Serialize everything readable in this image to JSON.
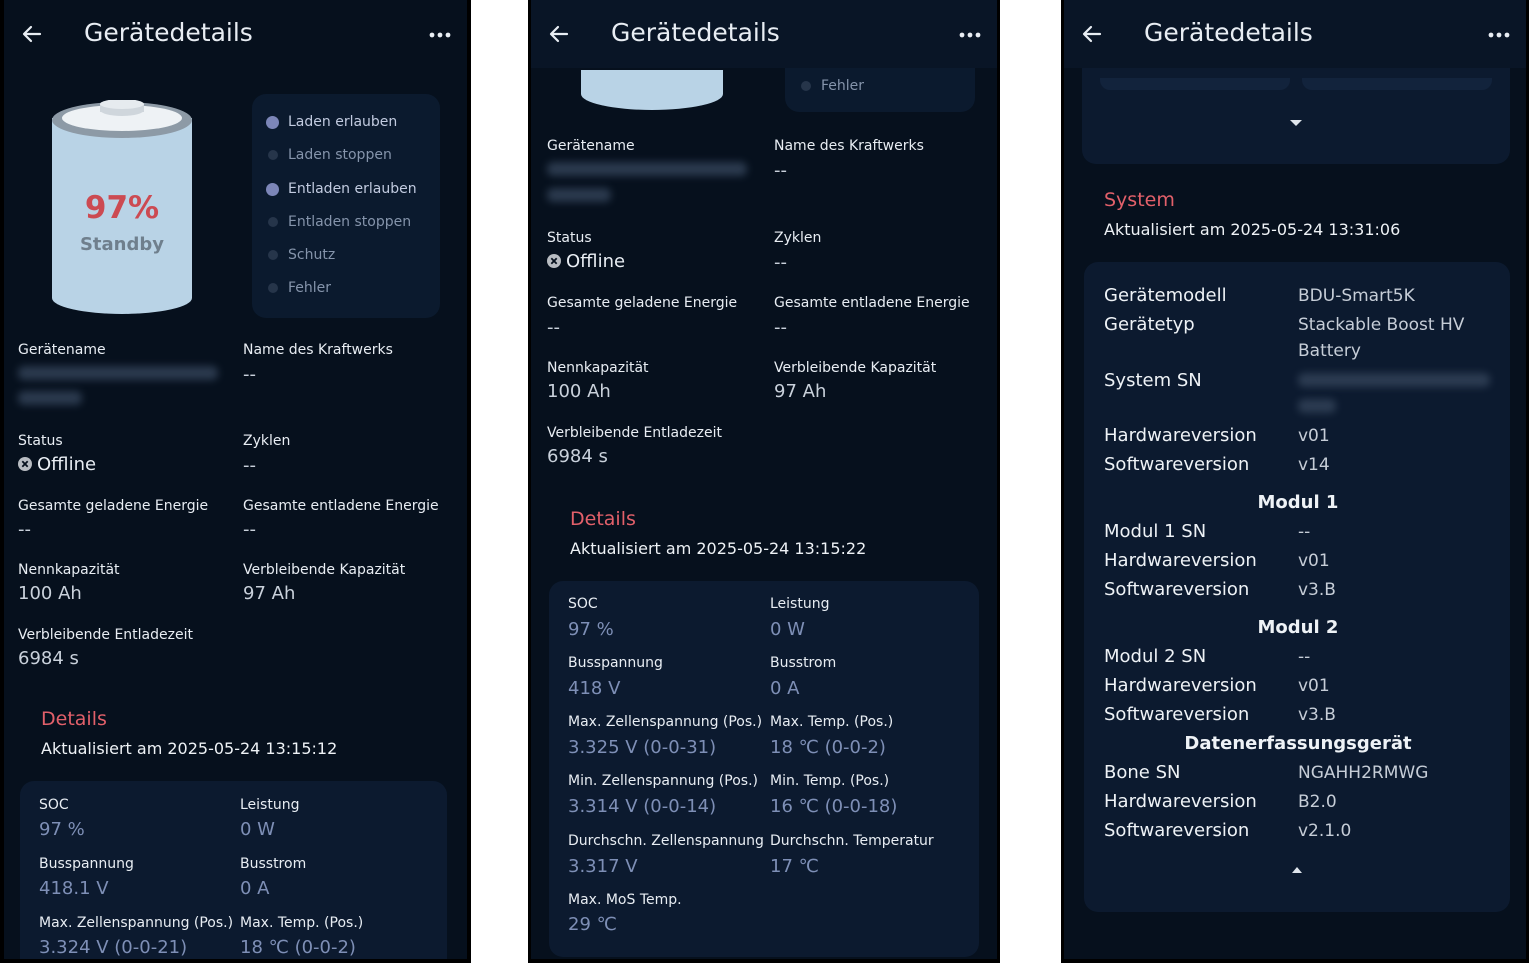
{
  "header": {
    "title": "Gerätedetails"
  },
  "battery": {
    "percent": "97%",
    "state": "Standby",
    "level": 0.97
  },
  "switches": [
    {
      "label": "Laden erlauben",
      "active": true
    },
    {
      "label": "Laden stoppen",
      "active": false
    },
    {
      "label": "Entladen erlauben",
      "active": true
    },
    {
      "label": "Entladen stoppen",
      "active": false
    },
    {
      "label": "Schutz",
      "active": false
    },
    {
      "label": "Fehler",
      "active": false
    }
  ],
  "info": {
    "device_name_label": "Gerätename",
    "plant_name_label": "Name des Kraftwerks",
    "plant_name_value": "--",
    "status_label": "Status",
    "status_value": "Offline",
    "cycles_label": "Zyklen",
    "cycles_value": "--",
    "charged_label": "Gesamte geladene Energie",
    "charged_value": "--",
    "discharged_label": "Gesamte entladene Energie",
    "discharged_value": "--",
    "nominal_label": "Nennkapazität",
    "nominal_value": "100 Ah",
    "remaining_cap_label": "Verbleibende Kapazität",
    "remaining_cap_value": "97 Ah",
    "remaining_time_label": "Verbleibende Entladezeit",
    "remaining_time_value": "6984 s"
  },
  "details1": {
    "title": "Details",
    "updated": "Aktualisiert am 2025-05-24 13:15:12",
    "soc_label": "SOC",
    "soc_value": "97 %",
    "power_label": "Leistung",
    "power_value": "0 W",
    "busv_label": "Busspannung",
    "busv_value": "418.1 V",
    "busa_label": "Busstrom",
    "busa_value": "0 A",
    "maxcell_label": "Max. Zellenspannung (Pos.)",
    "maxcell_value": "3.324 V (0-0-21)",
    "maxtemp_label": "Max. Temp. (Pos.)",
    "maxtemp_value": "18 ℃ (0-0-2)"
  },
  "details2": {
    "title": "Details",
    "updated": "Aktualisiert am 2025-05-24 13:15:22",
    "soc_label": "SOC",
    "soc_value": "97 %",
    "power_label": "Leistung",
    "power_value": "0 W",
    "busv_label": "Busspannung",
    "busv_value": "418 V",
    "busa_label": "Busstrom",
    "busa_value": "0 A",
    "maxcell_label": "Max. Zellenspannung (Pos.)",
    "maxcell_value": "3.325 V (0-0-31)",
    "maxtemp_label": "Max. Temp. (Pos.)",
    "maxtemp_value": "18 ℃ (0-0-2)",
    "mincell_label": "Min. Zellenspannung (Pos.)",
    "mincell_value": "3.314 V (0-0-14)",
    "mintemp_label": "Min. Temp. (Pos.)",
    "mintemp_value": "16 ℃ (0-0-18)",
    "avgcell_label": "Durchschn. Zellenspannung",
    "avgcell_value": "3.317 V",
    "avgtemp_label": "Durchschn. Temperatur",
    "avgtemp_value": "17 ℃",
    "mos_label": "Max. MoS Temp.",
    "mos_value": "29 ℃"
  },
  "system": {
    "title": "System",
    "updated": "Aktualisiert am 2025-05-24 13:31:06",
    "model_key": "Gerätemodell",
    "model_val": "BDU-Smart5K",
    "type_key": "Gerätetyp",
    "type_val1": "Stackable Boost HV",
    "type_val2": "Battery",
    "sn_key": "System SN",
    "hw_key": "Hardwareversion",
    "hw_val": "v01",
    "sw_key": "Softwareversion",
    "sw_val": "v14",
    "mod1_title": "Modul 1",
    "mod1_sn_key": "Modul 1 SN",
    "mod1_sn_val": "--",
    "mod1_hw_val": "v01",
    "mod1_sw_val": "v3.B",
    "mod2_title": "Modul 2",
    "mod2_sn_key": "Modul 2 SN",
    "mod2_sn_val": "--",
    "mod2_hw_val": "v01",
    "mod2_sw_val": "v3.B",
    "dl_title": "Datenerfassungsgerät",
    "bone_key": "Bone SN",
    "bone_val": "NGAHH2RMWG",
    "dl_hw_val": "B2.0",
    "dl_sw_val": "v2.1.0"
  }
}
